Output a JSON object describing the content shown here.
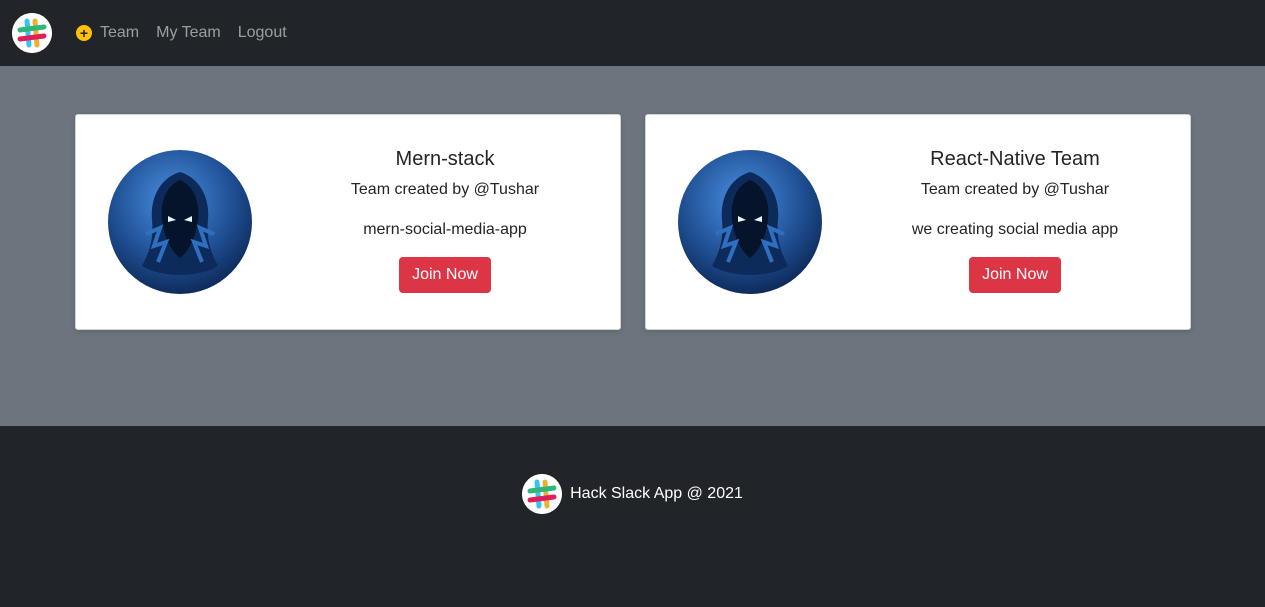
{
  "nav": {
    "logo_icon": "slack-logo-icon",
    "items": [
      {
        "label": "Team",
        "icon": "plus-circle-icon"
      },
      {
        "label": "My Team"
      },
      {
        "label": "Logout"
      }
    ]
  },
  "teams": [
    {
      "name": "Mern-stack",
      "creator": "Team created by @Tushar",
      "description": "mern-social-media-app",
      "button_label": "Join Now",
      "avatar_icon": "hooded-figure-avatar"
    },
    {
      "name": "React-Native Team",
      "creator": "Team created by @Tushar",
      "description": "we creating social media app",
      "button_label": "Join Now",
      "avatar_icon": "hooded-figure-avatar"
    }
  ],
  "footer": {
    "text": "Hack Slack App @ 2021",
    "logo_icon": "slack-logo-icon"
  },
  "colors": {
    "navbar": "#212529",
    "main_bg": "#6c757d",
    "button": "#dc3545",
    "plus_icon": "#ffc107"
  }
}
